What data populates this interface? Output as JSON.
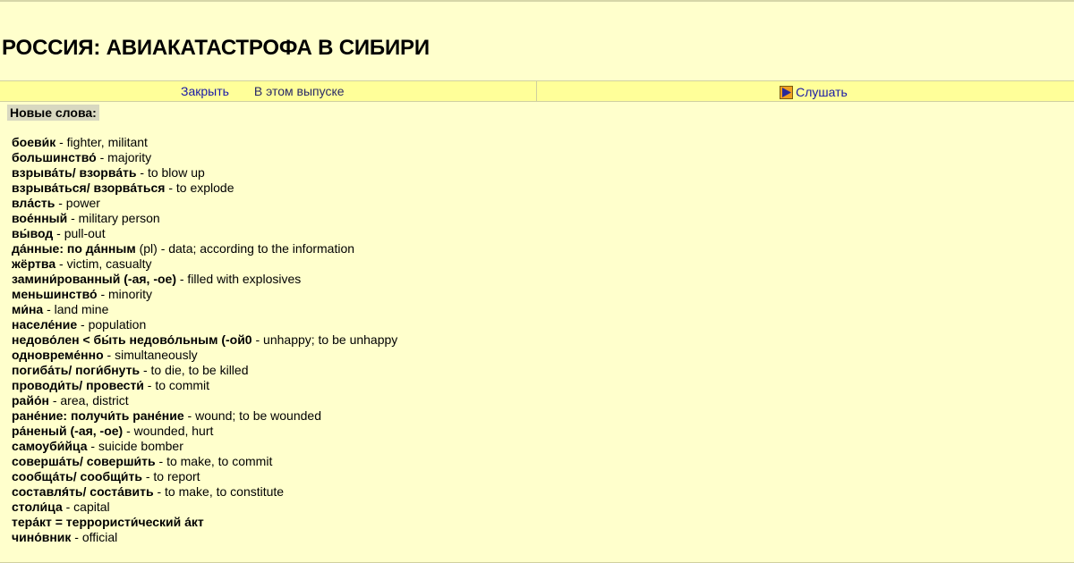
{
  "header": {
    "title": "РОССИЯ: АВИАКАТАСТРОФА В СИБИРИ"
  },
  "nav": {
    "close_label": "Закрыть",
    "issue_label": "В этом выпуске",
    "listen_label": "Слушать",
    "listen_icon": "play-icon"
  },
  "vocab": {
    "section_title": "Новые слова:",
    "items": [
      {
        "term": "боеви́к",
        "def": " - fighter, militant"
      },
      {
        "term": "большинство́",
        "def": " - majority"
      },
      {
        "term": "взрыва́ть/ взорва́ть",
        "def": " - to blow up"
      },
      {
        "term": "взрыва́ться/ взорва́ться",
        "def": " - to explode"
      },
      {
        "term": "вла́сть",
        "def": " - power"
      },
      {
        "term": "вое́нный",
        "def": " - military person"
      },
      {
        "term": "вы́вод",
        "def": " - pull-out"
      },
      {
        "term": "да́нные: по да́нным",
        "def": " (pl) - data; according to the information"
      },
      {
        "term": "жёртва",
        "def": " - victim, casualty"
      },
      {
        "term": "замини́рованный (-ая, -ое)",
        "def": " - filled with explosives"
      },
      {
        "term": "меньшинство́",
        "def": " - minority"
      },
      {
        "term": "ми́на",
        "def": " - land mine"
      },
      {
        "term": "населе́ние",
        "def": " - population"
      },
      {
        "term": "недово́лен < бы́ть недово́льным (-ой0",
        "def": " - unhappy; to be unhappy"
      },
      {
        "term": "одновреме́нно",
        "def": " - simultaneously"
      },
      {
        "term": "погиба́ть/ поги́бнуть",
        "def": " - to die, to be killed"
      },
      {
        "term": "проводи́ть/ провести́",
        "def": " - to commit"
      },
      {
        "term": "райо́н",
        "def": " - area, district"
      },
      {
        "term": "ране́ние: получи́ть ране́ние",
        "def": " - wound; to be wounded"
      },
      {
        "term": "ра́неный (-ая, -ое)",
        "def": " - wounded, hurt"
      },
      {
        "term": "самоуби́йца",
        "def": " - suicide bomber"
      },
      {
        "term": "соверша́ть/ соверши́ть",
        "def": " - to make, to commit"
      },
      {
        "term": "сообща́ть/ сообщи́ть",
        "def": " - to report"
      },
      {
        "term": "составля́ть/ соста́вить",
        "def": " - to make, to constitute"
      },
      {
        "term": "столи́ца",
        "def": " - capital"
      },
      {
        "term": "тера́кт = террористи́ческий а́кт",
        "def": ""
      },
      {
        "term": "чино́вник",
        "def": " - official"
      }
    ]
  },
  "colors": {
    "background": "#ffffcc",
    "nav_background": "#ffff99",
    "link": "#1a1aa6"
  }
}
